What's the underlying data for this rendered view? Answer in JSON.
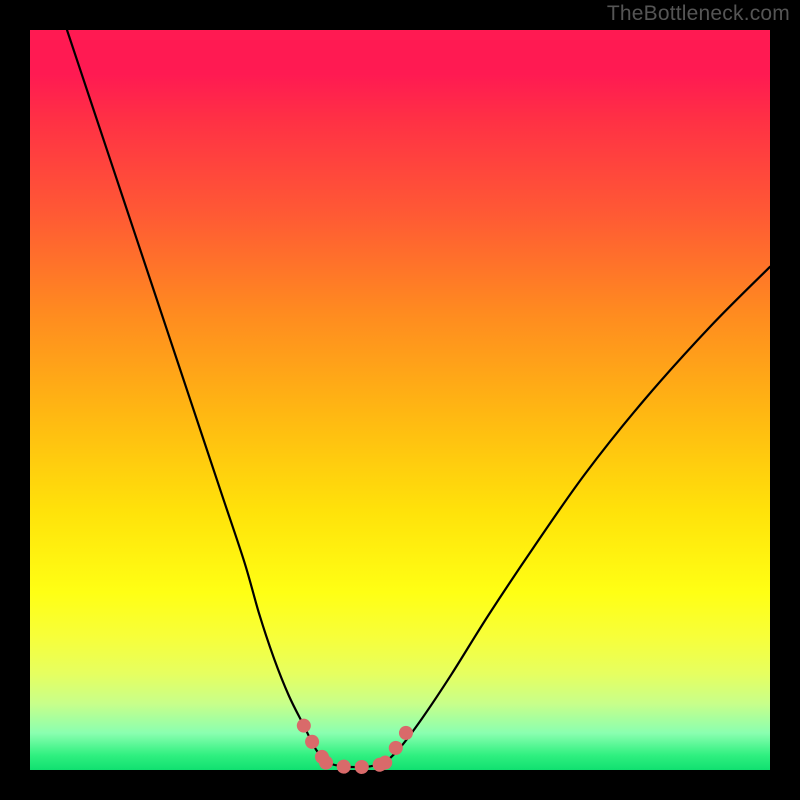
{
  "watermark": "TheBottleneck.com",
  "colors": {
    "bg": "#000000",
    "curve": "#000000",
    "marker": "#d96a6a",
    "gradient_top": "#ff1a52",
    "gradient_mid": "#ffe20a",
    "gradient_bot": "#10e070"
  },
  "chart_data": {
    "type": "line",
    "title": "",
    "xlabel": "",
    "ylabel": "",
    "xlim": [
      0,
      100
    ],
    "ylim": [
      0,
      100
    ],
    "grid": false,
    "legend": false,
    "notes": "Bottleneck-style curve. Y axis ~ bottleneck percentage (0 at bottom). Two branches form a V with a flat minimum region. No tick labels are shown in the image; values below are estimated from curve position within the plot area.",
    "series": [
      {
        "name": "left-branch",
        "x": [
          5,
          8,
          11,
          14,
          17,
          20,
          23,
          26,
          29,
          31,
          33,
          35,
          37,
          38.5,
          40
        ],
        "y": [
          100,
          91,
          82,
          73,
          64,
          55,
          46,
          37,
          28,
          21,
          15,
          10,
          6,
          3,
          1
        ]
      },
      {
        "name": "valley-floor",
        "x": [
          40,
          42,
          44,
          46,
          48
        ],
        "y": [
          1,
          0.5,
          0.4,
          0.5,
          1
        ]
      },
      {
        "name": "right-branch",
        "x": [
          48,
          50,
          53,
          57,
          62,
          68,
          75,
          83,
          92,
          100
        ],
        "y": [
          1,
          3,
          7,
          13,
          21,
          30,
          40,
          50,
          60,
          68
        ]
      },
      {
        "name": "highlight-left",
        "x": [
          37,
          37.7,
          38.3,
          38.9,
          39.5,
          40
        ],
        "y": [
          6,
          4.6,
          3.5,
          2.6,
          1.7,
          1
        ]
      },
      {
        "name": "highlight-floor",
        "x": [
          40,
          41.5,
          43,
          44.5,
          46,
          47.2,
          48
        ],
        "y": [
          1,
          0.6,
          0.4,
          0.4,
          0.5,
          0.7,
          1
        ]
      },
      {
        "name": "highlight-right",
        "x": [
          48,
          48.6,
          49.3,
          50,
          50.8,
          51.5
        ],
        "y": [
          1,
          1.8,
          2.8,
          3.8,
          5,
          6.5
        ]
      }
    ]
  }
}
